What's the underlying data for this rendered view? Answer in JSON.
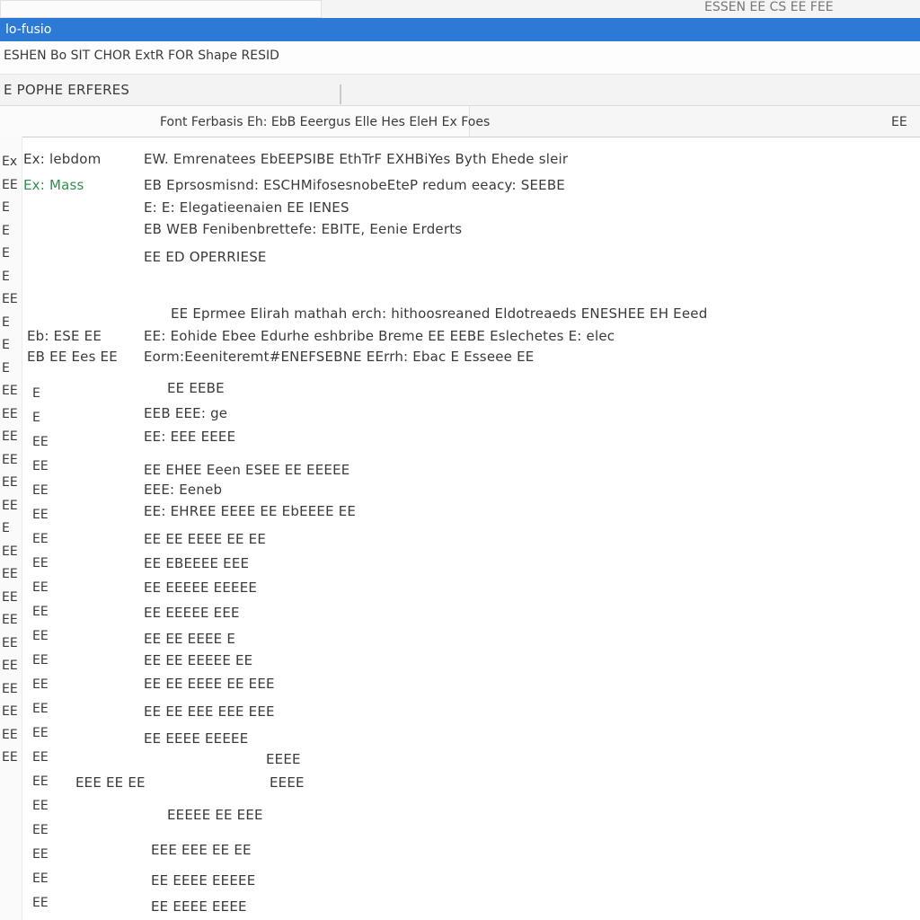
{
  "window": {
    "title_left": "lo-fusio",
    "title_right": "ESSEN EE CS EE FEE"
  },
  "toolbar": {
    "menu_text": "ESHEN Bo SIT CHOR ExtR FOR Shape RESID"
  },
  "path": {
    "label": "E POPHE ERFERES"
  },
  "columns": {
    "header": "Font Ferbasis Eh: EbB Eeergus Elle Hes EleH Ex Foes",
    "right": "EE"
  },
  "content": {
    "top_left": [
      "Ex: lebdom",
      "Ex: Mass"
    ],
    "lines_top": [
      "EW. Emrenatees EbEEPSIBE EthTrF EXHBiYes  Byth Ehede sleir",
      "EB Eprsosmisnd: ESCHMifosesnobeEteP redum  eeacy: SEEBE",
      "E: E: Elegatieenaien EE IENES",
      "EB WEB Fenibenbrettefe: EBITE, Eenie Erderts",
      "EE ED OPERRIESE"
    ],
    "block_mid": [
      "EE Eprmee Elirah mathah erch: hithoosreaned  Eldotreaeds ENESHEE EH Eeed",
      "EE: Eohide Ebee Edurhe eshbribe  Breme EE  EEBE Eslechetes  E: elec",
      "Eorm:Eeeniteremt#ENEFSEBNE EErrh: Ebac E   Esseee EE"
    ],
    "mid_left": [
      "Eb: ESE  EE",
      "EB EE Ees  EE"
    ],
    "rows": [
      "EE EEBE",
      "EEB EEE: ge",
      "EE: EEE  EEEE",
      "EE EHEE Eeen ESEE EE EEEEE",
      "EEE: Eeneb",
      "EE: EHREE EEEE EE EbEEEE  EE",
      "EE EE EEEE EE EE",
      "EE EBEEEE EEE",
      "EE EEEEE EEEEE",
      "EE EEEEE EEE",
      "EE EE EEEE E",
      "EE EE EEEEE EE",
      "EE EE EEEE EE EEE",
      "EE EE EEE EEE EEE",
      "EE EEEE EEEEE",
      "EEEEE EE EEE",
      "EEE EEE EE EE",
      "EE EEEE EEEEE",
      "EE EEEE EEEE"
    ],
    "mid_note": "EEEE",
    "status_left": "EEE EE EE",
    "gutter": [
      "Ex",
      "EE",
      "E",
      "E",
      "E",
      "E",
      "EE",
      "E",
      "E",
      "E",
      "EE",
      "EE",
      "EE",
      "EE",
      "EE",
      "EE",
      "E",
      "EE",
      "EE",
      "EE",
      "EE",
      "EE",
      "EE",
      "EE",
      "EE",
      "EE",
      "EE"
    ],
    "gutter2": [
      "E",
      "E",
      "EE",
      "EE",
      "EE",
      "EE",
      "EE",
      "EE",
      "EE",
      "EE",
      "EE",
      "EE",
      "EE",
      "EE",
      "EE",
      "EE",
      "EE",
      "EE",
      "EE",
      "EE",
      "EE",
      "EE"
    ]
  }
}
